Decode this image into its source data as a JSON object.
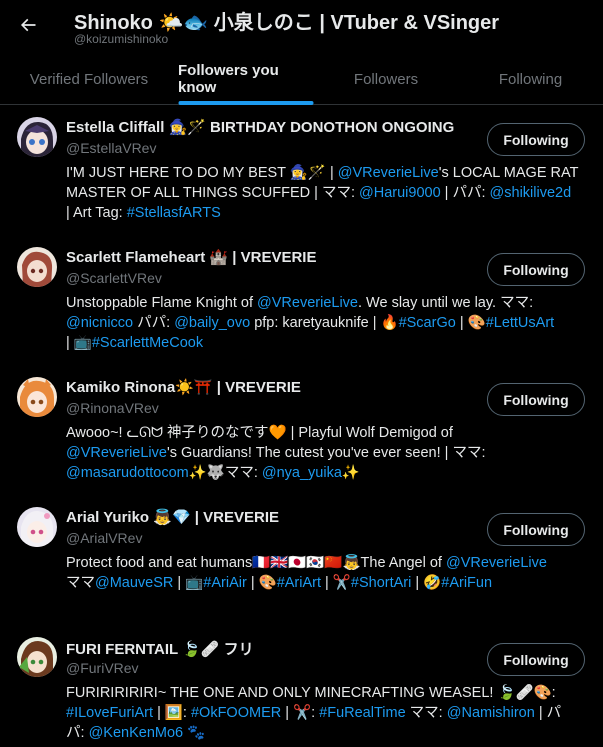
{
  "header": {
    "title": "Shinoko 🌤️🐟 小泉しのこ | VTuber & VSinger",
    "handle": "@koizumishinoko"
  },
  "tabs": [
    {
      "label": "Verified Followers"
    },
    {
      "label": "Followers you know"
    },
    {
      "label": "Followers"
    },
    {
      "label": "Following"
    }
  ],
  "accent_color": "#1d9bf0",
  "users": [
    {
      "name": "Estella Cliffall 🧙‍♀️🪄 BIRTHDAY DONOTHON ONGOING",
      "handle": "@EstellaVRev",
      "button": "Following",
      "bio_lines": [
        [
          {
            "t": "I'M JUST HERE TO DO MY BEST 🧙‍♀️🪄 | "
          },
          {
            "t": "@VReverieLive",
            "link": true
          },
          {
            "t": "'s LOCAL MAGE RAT"
          }
        ],
        [
          {
            "t": "MASTER OF ALL THINGS SCUFFED | ママ: "
          },
          {
            "t": "@Harui9000",
            "link": true
          },
          {
            "t": " | パパ: "
          },
          {
            "t": "@shikilive2d",
            "link": true
          }
        ],
        [
          {
            "t": "| Art Tag: "
          },
          {
            "t": "#StellasfARTS",
            "link": true
          }
        ]
      ]
    },
    {
      "name": "Scarlett Flameheart 🏰 | VREVERIE",
      "handle": "@ScarlettVRev",
      "button": "Following",
      "bio_lines": [
        [
          {
            "t": "Unstoppable Flame Knight of "
          },
          {
            "t": "@VReverieLive",
            "link": true
          },
          {
            "t": ". We slay until we lay. ママ:"
          }
        ],
        [
          {
            "t": "@nicnicco",
            "link": true
          },
          {
            "t": " パパ: "
          },
          {
            "t": "@baily_ovo",
            "link": true
          },
          {
            "t": " pfp: karetyauknife | 🔥"
          },
          {
            "t": "#ScarGo",
            "link": true
          },
          {
            "t": " | 🎨"
          },
          {
            "t": "#LettUsArt",
            "link": true
          }
        ],
        [
          {
            "t": "| 📺"
          },
          {
            "t": "#ScarlettMeCook",
            "link": true
          }
        ]
      ]
    },
    {
      "name": "Kamiko Rinona☀️⛩️ | VREVERIE",
      "handle": "@RinonaVRev",
      "button": "Following",
      "bio_lines": [
        [
          {
            "t": "Awooo~! ᓚᘏᗢ 神子りのなです🧡 | Playful Wolf Demigod of"
          }
        ],
        [
          {
            "t": "@VReverieLive",
            "link": true
          },
          {
            "t": "'s Guardians! The cutest you've ever seen! | ママ:"
          }
        ],
        [
          {
            "t": "@masarudottocom",
            "link": true
          },
          {
            "t": "✨🐺ママ: "
          },
          {
            "t": "@nya_yuika",
            "link": true
          },
          {
            "t": "✨"
          }
        ]
      ]
    },
    {
      "name": "Arial Yuriko 👼💎 | VREVERIE",
      "handle": "@ArialVRev",
      "button": "Following",
      "bio_lines": [
        [
          {
            "t": "Protect food and eat humans🇫🇷🇬🇧🇯🇵🇰🇷🇨🇳👼The Angel of "
          },
          {
            "t": "@VReverieLive",
            "link": true
          }
        ],
        [
          {
            "t": "ママ"
          },
          {
            "t": "@MauveSR",
            "link": true
          },
          {
            "t": " | 📺"
          },
          {
            "t": "#AriAir",
            "link": true
          },
          {
            "t": " | 🎨"
          },
          {
            "t": "#AriArt",
            "link": true
          },
          {
            "t": " | ✂️"
          },
          {
            "t": "#ShortAri",
            "link": true
          },
          {
            "t": " | 🤣"
          },
          {
            "t": "#AriFun",
            "link": true
          }
        ]
      ]
    },
    {
      "name": "FURI FERNTAIL 🍃🩹 フリ",
      "handle": "@FuriVRev",
      "button": "Following",
      "bio_lines": [
        [
          {
            "t": "FURIRIRIRIRI~ THE ONE AND ONLY MINECRAFTING WEASEL! 🍃🩹🎨:"
          }
        ],
        [
          {
            "t": "#ILoveFuriArt",
            "link": true
          },
          {
            "t": " | 🖼️: "
          },
          {
            "t": "#OkFOOMER",
            "link": true
          },
          {
            "t": " | ✂️: "
          },
          {
            "t": "#FuRealTime",
            "link": true
          },
          {
            "t": " ママ: "
          },
          {
            "t": "@Namishiron",
            "link": true
          },
          {
            "t": " | パ"
          }
        ],
        [
          {
            "t": "パ: "
          },
          {
            "t": "@KenKenMo6",
            "link": true
          },
          {
            "t": " 🐾"
          }
        ]
      ]
    }
  ]
}
